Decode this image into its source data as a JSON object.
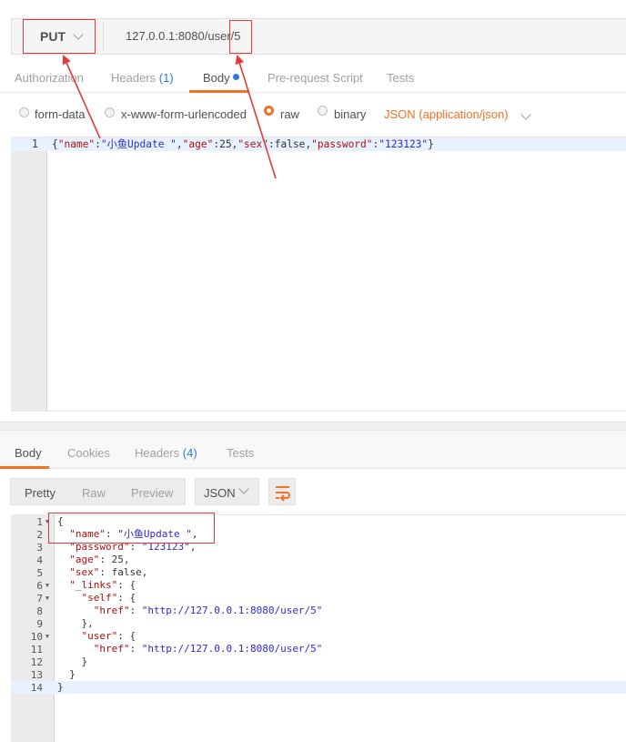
{
  "request": {
    "method": "PUT",
    "url": "127.0.0.1:8080/user/5",
    "tabs": [
      {
        "label": "Authorization",
        "count": ""
      },
      {
        "label": "Headers",
        "count": "(1)"
      },
      {
        "label": "Body",
        "count": ""
      },
      {
        "label": "Pre-request Script",
        "count": ""
      },
      {
        "label": "Tests",
        "count": ""
      }
    ],
    "active_tab": "Body",
    "body_types": [
      "form-data",
      "x-www-form-urlencoded",
      "raw",
      "binary"
    ],
    "selected_body_type": "raw",
    "content_type": "JSON (application/json)",
    "editor": {
      "line_number": "1",
      "code": [
        {
          "t": "{",
          "c": "p"
        },
        {
          "t": "\"name\"",
          "c": "k"
        },
        {
          "t": ":",
          "c": "p"
        },
        {
          "t": "\"小鱼Update \"",
          "c": "s"
        },
        {
          "t": ",",
          "c": "p"
        },
        {
          "t": "\"age\"",
          "c": "k"
        },
        {
          "t": ":25,",
          "c": "n"
        },
        {
          "t": "\"sex\"",
          "c": "k"
        },
        {
          "t": ":false,",
          "c": "n"
        },
        {
          "t": "\"password\"",
          "c": "k"
        },
        {
          "t": ":",
          "c": "p"
        },
        {
          "t": "\"123123\"",
          "c": "s"
        },
        {
          "t": "}",
          "c": "p"
        }
      ]
    }
  },
  "response": {
    "tabs": [
      {
        "label": "Body",
        "count": ""
      },
      {
        "label": "Cookies",
        "count": ""
      },
      {
        "label": "Headers",
        "count": "(4)"
      },
      {
        "label": "Tests",
        "count": ""
      }
    ],
    "active_tab": "Body",
    "views": [
      "Pretty",
      "Raw",
      "Preview"
    ],
    "active_view": "Pretty",
    "format": "JSON",
    "lines": [
      {
        "no": "1",
        "fold": true,
        "segs": [
          {
            "t": "{",
            "c": "p"
          }
        ]
      },
      {
        "no": "2",
        "fold": false,
        "segs": [
          {
            "t": "  ",
            "c": "p"
          },
          {
            "t": "\"name\"",
            "c": "k"
          },
          {
            "t": ": ",
            "c": "p"
          },
          {
            "t": "\"小鱼Update \"",
            "c": "s"
          },
          {
            "t": ",",
            "c": "p"
          }
        ]
      },
      {
        "no": "3",
        "fold": false,
        "segs": [
          {
            "t": "  ",
            "c": "p"
          },
          {
            "t": "\"password\"",
            "c": "k"
          },
          {
            "t": ": ",
            "c": "p"
          },
          {
            "t": "\"123123\"",
            "c": "s"
          },
          {
            "t": ",",
            "c": "p"
          }
        ]
      },
      {
        "no": "4",
        "fold": false,
        "segs": [
          {
            "t": "  ",
            "c": "p"
          },
          {
            "t": "\"age\"",
            "c": "k"
          },
          {
            "t": ": 25,",
            "c": "n"
          }
        ]
      },
      {
        "no": "5",
        "fold": false,
        "segs": [
          {
            "t": "  ",
            "c": "p"
          },
          {
            "t": "\"sex\"",
            "c": "k"
          },
          {
            "t": ": false,",
            "c": "n"
          }
        ]
      },
      {
        "no": "6",
        "fold": true,
        "segs": [
          {
            "t": "  ",
            "c": "p"
          },
          {
            "t": "\"_links\"",
            "c": "k"
          },
          {
            "t": ": {",
            "c": "p"
          }
        ]
      },
      {
        "no": "7",
        "fold": true,
        "segs": [
          {
            "t": "    ",
            "c": "p"
          },
          {
            "t": "\"self\"",
            "c": "k"
          },
          {
            "t": ": {",
            "c": "p"
          }
        ]
      },
      {
        "no": "8",
        "fold": false,
        "segs": [
          {
            "t": "      ",
            "c": "p"
          },
          {
            "t": "\"href\"",
            "c": "k"
          },
          {
            "t": ": ",
            "c": "p"
          },
          {
            "t": "\"http://127.0.0.1:8080/user/5\"",
            "c": "s"
          }
        ]
      },
      {
        "no": "9",
        "fold": false,
        "segs": [
          {
            "t": "    },",
            "c": "p"
          }
        ]
      },
      {
        "no": "10",
        "fold": true,
        "segs": [
          {
            "t": "    ",
            "c": "p"
          },
          {
            "t": "\"user\"",
            "c": "k"
          },
          {
            "t": ": {",
            "c": "p"
          }
        ]
      },
      {
        "no": "11",
        "fold": false,
        "segs": [
          {
            "t": "      ",
            "c": "p"
          },
          {
            "t": "\"href\"",
            "c": "k"
          },
          {
            "t": ": ",
            "c": "p"
          },
          {
            "t": "\"http://127.0.0.1:8080/user/5\"",
            "c": "s"
          }
        ]
      },
      {
        "no": "12",
        "fold": false,
        "segs": [
          {
            "t": "    }",
            "c": "p"
          }
        ]
      },
      {
        "no": "13",
        "fold": false,
        "segs": [
          {
            "t": "  }",
            "c": "p"
          }
        ]
      },
      {
        "no": "14",
        "fold": false,
        "segs": [
          {
            "t": "}",
            "c": "p"
          }
        ]
      }
    ]
  },
  "icons": {
    "method_dropdown": "chevron-down-icon",
    "content_type_dropdown": "chevron-down-icon",
    "format_dropdown": "chevron-down-icon",
    "wrap": "wrap-lines-icon",
    "body_dot": "unsaved-dot-icon"
  },
  "colors": {
    "accent": "#f47023",
    "count": "#2d7ad6",
    "annotation": "#e53935",
    "json_key": "#aa1111",
    "json_string": "#2b2bd1"
  }
}
